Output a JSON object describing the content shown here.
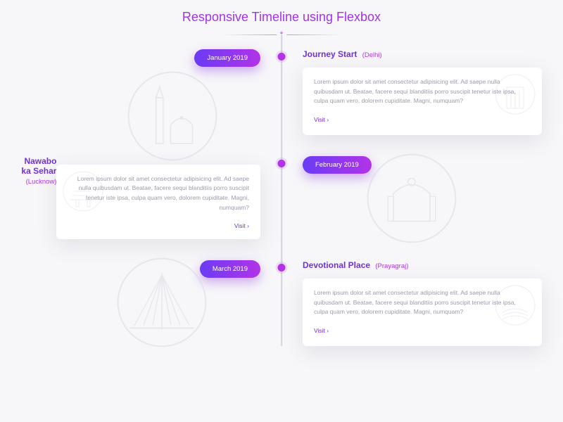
{
  "title": "Responsive Timeline using Flexbox",
  "entries": [
    {
      "date": "January 2019",
      "title": "Journey Start",
      "location": "(Delhi)",
      "body": "Lorem ipsum dolor sit amet consectetur adipisicing elit. Ad saepe nulla quibusdam ut. Beatae, facere sequi blanditiis porro suscipit tenetur iste ipsa, culpa quam vero, dolorem cupiditate. Magni, numquam?",
      "link": "Visit ›",
      "side": "right"
    },
    {
      "date": "February 2019",
      "title": "Nawabo ka Sehar",
      "location": "(Lucknow)",
      "body": "Lorem ipsum dolor sit amet consectetur adipisicing elit. Ad saepe nulla quibusdam ut. Beatae, facere sequi blanditiis porro suscipit tenetur iste ipsa, culpa quam vero, dolorem cupiditate. Magni, numquam?",
      "link": "Visit ›",
      "side": "left"
    },
    {
      "date": "March 2019",
      "title": "Devotional Place",
      "location": "(Prayagraj)",
      "body": "Lorem ipsum dolor sit amet consectetur adipisicing elit. Ad saepe nulla quibusdam ut. Beatae, facere sequi blanditiis porro suscipit tenetur iste ipsa, culpa quam vero, dolorem cupiditate. Magni, numquam?",
      "link": "Visit ›",
      "side": "right"
    }
  ]
}
